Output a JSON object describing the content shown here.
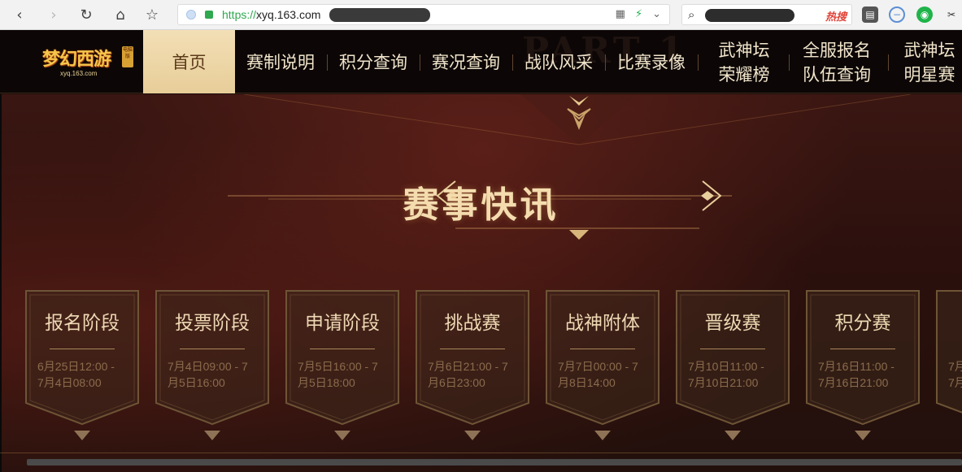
{
  "browser": {
    "url_scheme": "https://",
    "url_host": "xyq.163.com",
    "search_hot_label": "热搜"
  },
  "site": {
    "logo_text": "梦幻西游",
    "logo_sub": "xyq.163.com",
    "logo_tag": "电脑版",
    "nav": {
      "home": "首页",
      "rules": "赛制说明",
      "points": "积分查询",
      "matches": "赛况查询",
      "teams": "战队风采",
      "videos": "比赛录像",
      "honor_line1": "武神坛",
      "honor_line2": "荣耀榜",
      "signup_line1": "全服报名",
      "signup_line2": "队伍查询",
      "stars_line1": "武神坛",
      "stars_line2": "明星赛"
    },
    "ghost_text": "PART 1"
  },
  "section": {
    "title": "赛事快讯"
  },
  "stages": [
    {
      "title": "报名阶段",
      "time_line1": "6月25日12:00 -",
      "time_line2": "7月4日08:00"
    },
    {
      "title": "投票阶段",
      "time_line1": "7月4日09:00 - 7",
      "time_line2": "月5日16:00"
    },
    {
      "title": "申请阶段",
      "time_line1": "7月5日16:00 - 7",
      "time_line2": "月5日18:00"
    },
    {
      "title": "挑战赛",
      "time_line1": "7月6日21:00 - 7",
      "time_line2": "月6日23:00"
    },
    {
      "title": "战神附体",
      "time_line1": "7月7日00:00 - 7",
      "time_line2": "月8日14:00"
    },
    {
      "title": "晋级赛",
      "time_line1": "7月10日11:00 -",
      "time_line2": "7月10日21:00"
    },
    {
      "title": "积分赛",
      "time_line1": "7月16日11:00 -",
      "time_line2": "7月16日21:00"
    },
    {
      "title": "",
      "time_line1": "7月",
      "time_line2": "7月"
    }
  ],
  "colors": {
    "accent_gold": "#f4dcae",
    "nav_active_bg": "#e7cd98",
    "page_bg": "#2b100d"
  }
}
